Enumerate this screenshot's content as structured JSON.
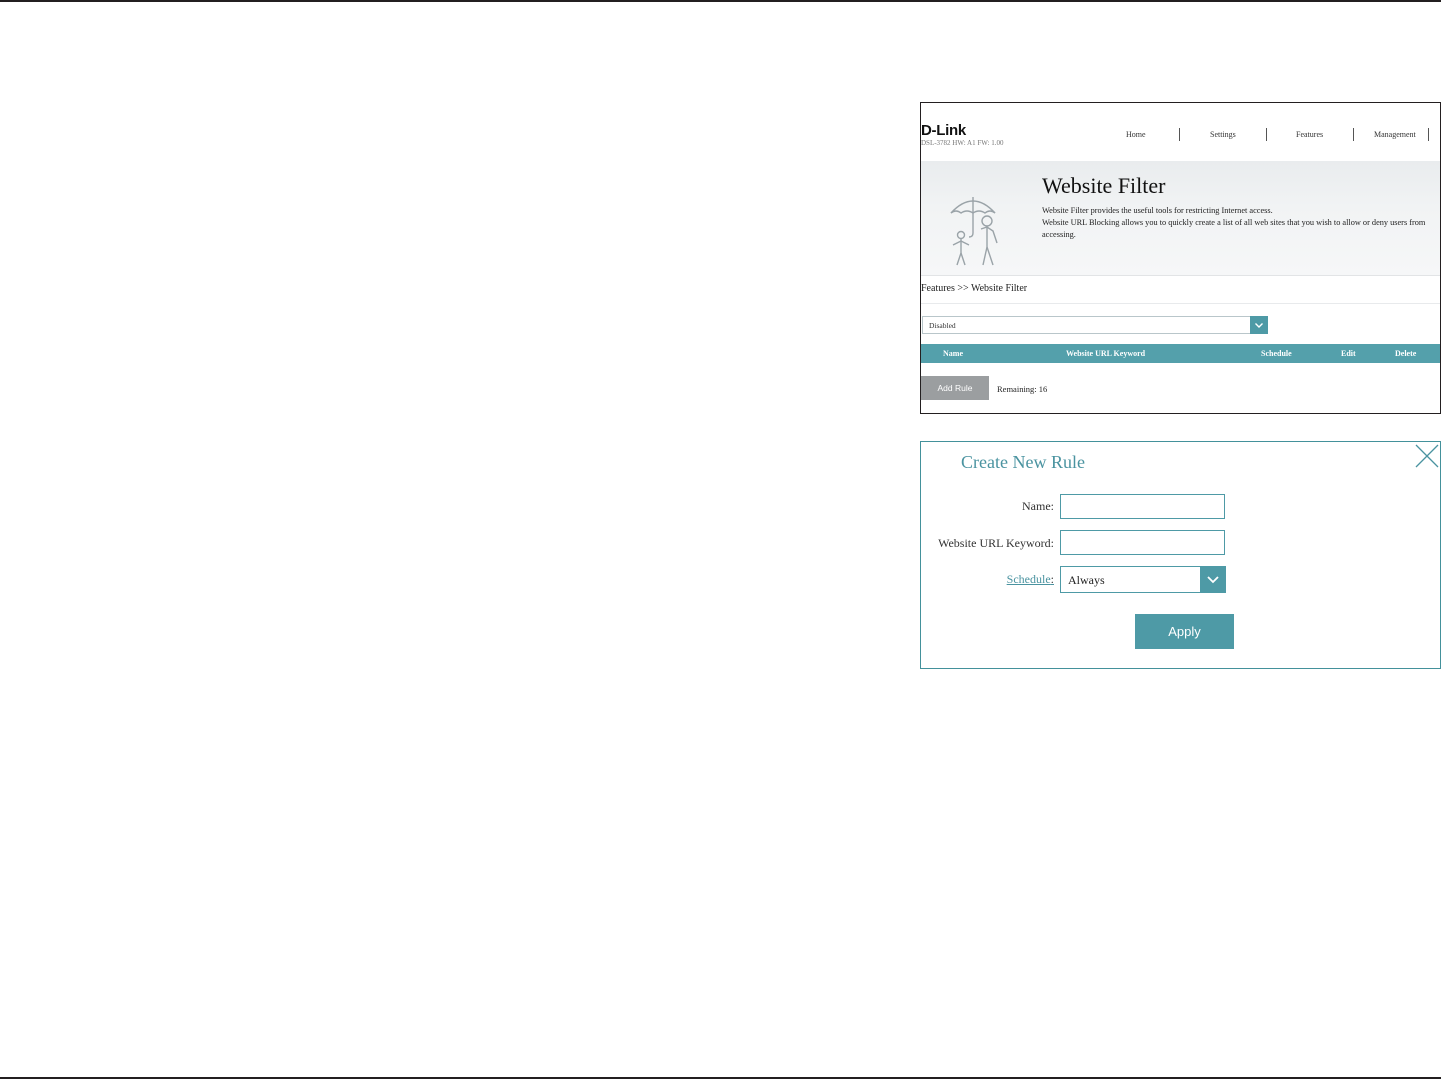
{
  "screenshot1": {
    "logo": "D-Link",
    "device_info": "DSL-3782  HW: A1  FW: 1.00",
    "nav": [
      "Home",
      "Settings",
      "Features",
      "Management"
    ],
    "hero": {
      "title": "Website Filter",
      "desc1": "Website Filter provides the useful tools for restricting Internet access.",
      "desc2": "Website URL Blocking allows you to quickly create a list of all web sites that you wish to allow or deny users from accessing."
    },
    "breadcrumb": "Features >> Website Filter",
    "filter_mode": "Disabled",
    "table_headers": [
      "Name",
      "Website URL Keyword",
      "Schedule",
      "Edit",
      "Delete"
    ],
    "add_rule_label": "Add Rule",
    "remaining": "Remaining: 16"
  },
  "modal": {
    "title": "Create New Rule",
    "name_label": "Name:",
    "name_value": "",
    "keyword_label": "Website URL Keyword:",
    "keyword_value": "",
    "schedule_label": "Schedule",
    "schedule_colon": ":",
    "schedule_value": "Always",
    "apply_label": "Apply"
  },
  "colors": {
    "accent": "#4e9aa6",
    "table_header": "#54a0ab",
    "add_rule_button": "#9b9ea0",
    "border_dark": "#231f20"
  },
  "icons": [
    "family-umbrella-icon",
    "chevron-down-icon",
    "close-icon"
  ]
}
